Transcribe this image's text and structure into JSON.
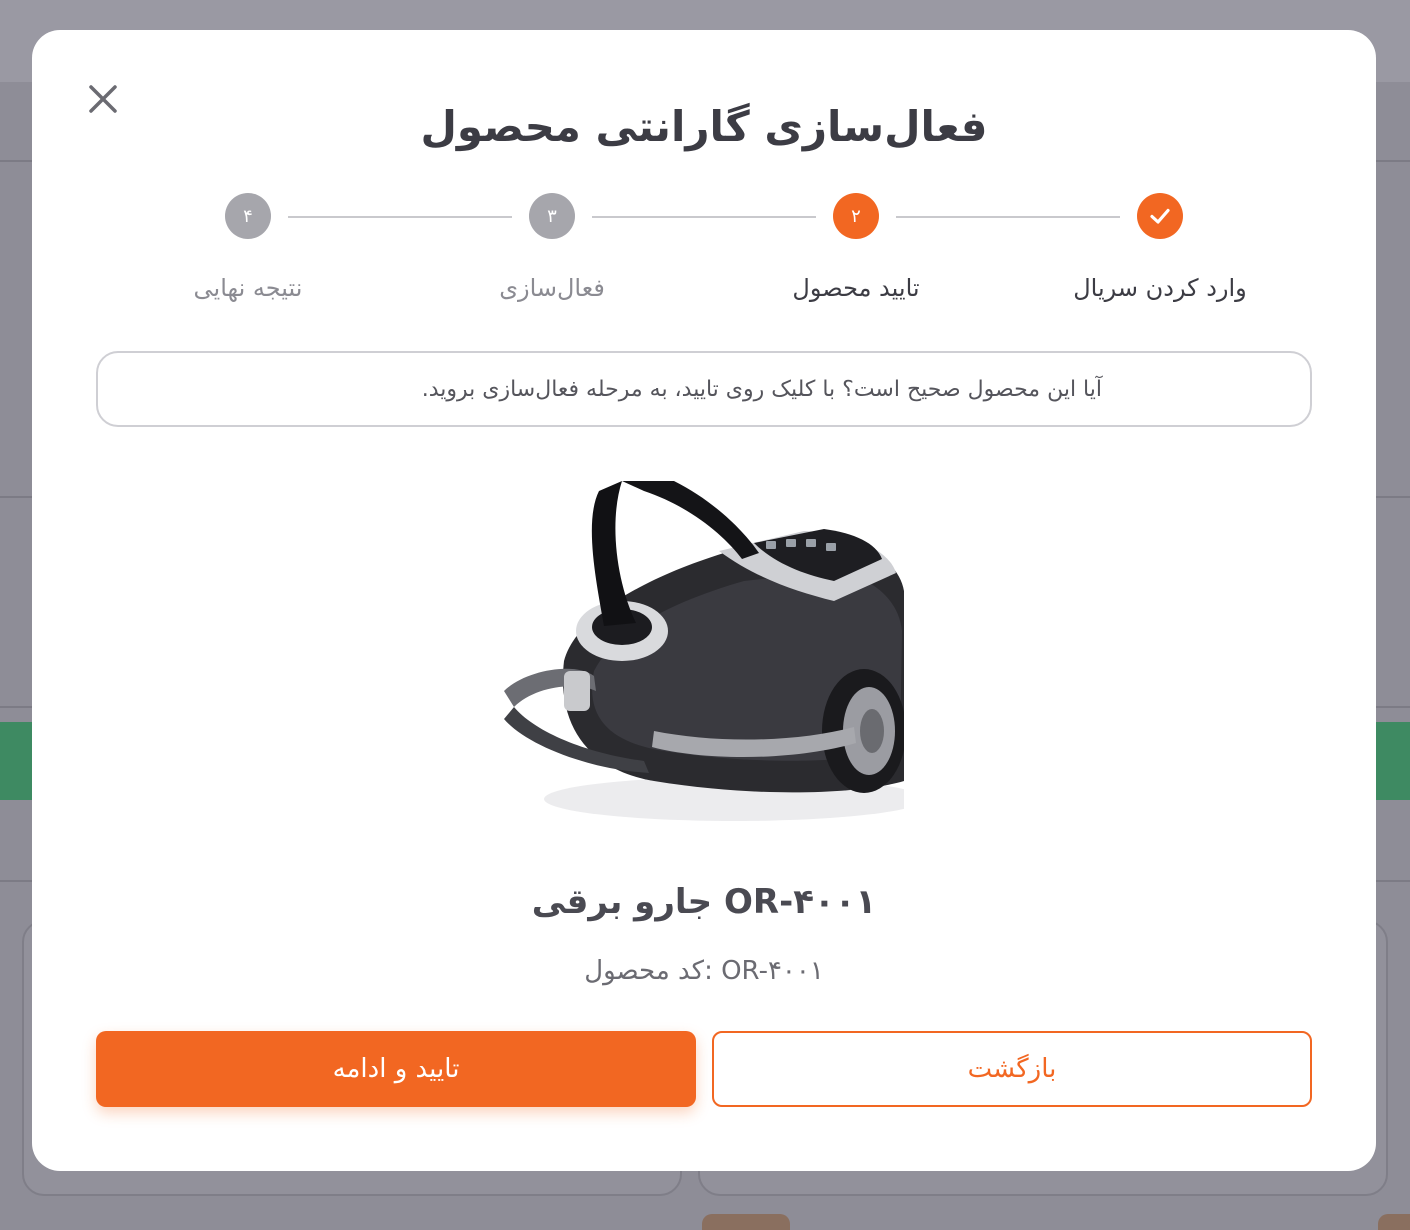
{
  "modal": {
    "title": "فعال‌سازی گارانتی محصول",
    "close_icon": "close-icon",
    "steps": [
      {
        "label": "وارد کردن سریال",
        "number": "",
        "state": "done"
      },
      {
        "label": "تایید محصول",
        "number": "۲",
        "state": "active"
      },
      {
        "label": "فعال‌سازی",
        "number": "۳",
        "state": "todo"
      },
      {
        "label": "نتیجه نهایی",
        "number": "۴",
        "state": "todo"
      }
    ],
    "hint": "آیا این محصول صحیح است؟ با کلیک روی تایید، به مرحله فعال‌سازی بروید.",
    "product": {
      "name": "جارو برقی OR-۴۰۰۱",
      "code": "کد محصول: OR-۴۰۰۱"
    },
    "buttons": {
      "confirm": "تایید و ادامه",
      "back": "بازگشت"
    }
  },
  "colors": {
    "accent": "#f26722",
    "overlay": "#8e8d97",
    "step_inactive": "#a6a6ac"
  }
}
